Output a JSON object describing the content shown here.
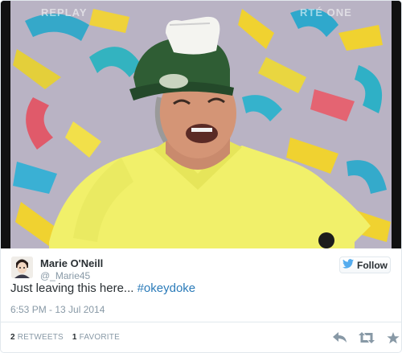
{
  "media": {
    "watermark_left": "REPLAY",
    "watermark_right": "RTÉ ONE"
  },
  "tweet": {
    "author_name": "Marie O'Neill",
    "author_handle": "@_Marie45",
    "follow_label": "Follow",
    "text": "Just leaving this here... ",
    "hashtag": "#okeydoke",
    "timestamp": "6:53 PM - 13 Jul 2014"
  },
  "stats": {
    "retweets_count": "2",
    "retweets_label": "RETWEETS",
    "favorites_count": "1",
    "favorites_label": "FAVORITE"
  },
  "icons": {
    "follow": "twitter-bird-icon",
    "reply": "reply-icon",
    "retweet": "retweet-icon",
    "favorite": "star-icon"
  },
  "colors": {
    "link": "#2b7bb9",
    "muted": "#8899a6",
    "text": "#292f33",
    "twitter_blue": "#55acee"
  }
}
